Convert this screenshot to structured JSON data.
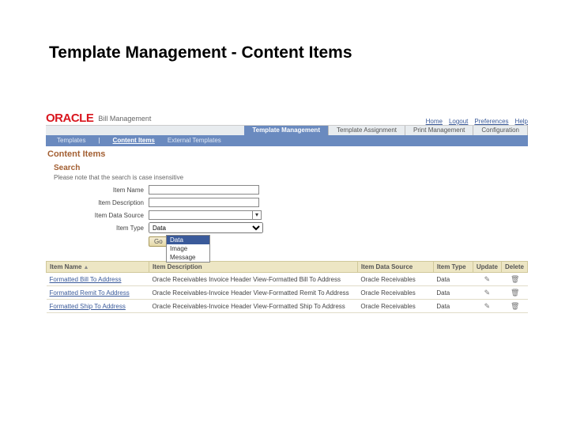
{
  "slide": {
    "title": "Template Management  - Content Items"
  },
  "header": {
    "brand": "ORACLE",
    "app_name": "Bill Management",
    "links": {
      "home": "Home",
      "logout": "Logout",
      "prefs": "Preferences",
      "help": "Help"
    }
  },
  "tabs": {
    "items": [
      {
        "label": "Template Management",
        "active": true
      },
      {
        "label": "Template Assignment",
        "active": false
      },
      {
        "label": "Print Management",
        "active": false
      },
      {
        "label": "Configuration",
        "active": false
      }
    ]
  },
  "subtabs": {
    "items": [
      {
        "label": "Templates",
        "active": false
      },
      {
        "label": "Content Items",
        "active": true
      },
      {
        "label": "External Templates",
        "active": false
      }
    ]
  },
  "page": {
    "heading": "Content Items"
  },
  "search": {
    "heading": "Search",
    "hint": "Please note that the search is case insensitive",
    "name_label": "Item Name",
    "name_value": "",
    "desc_label": "Item Description",
    "desc_value": "",
    "datasource_label": "Item Data Source",
    "datasource_value": "",
    "type_label": "Item Type",
    "type_value": "Data",
    "go_label": "Go",
    "type_options": [
      "Data",
      "Image",
      "Message"
    ]
  },
  "results": {
    "columns": {
      "name": "Item Name",
      "desc": "Item Description",
      "datasource": "Item Data Source",
      "type": "Item Type",
      "update": "Update",
      "delete": "Delete"
    },
    "rows": [
      {
        "name": "Formatted Bill To Address",
        "desc": "Oracle Receivables Invoice Header View-Formatted Bill To Address",
        "datasource": "Oracle Receivables",
        "type": "Data"
      },
      {
        "name": "Formatted Remit To Address",
        "desc": "Oracle Receivables-Invoice Header View-Formatted Remit To Address",
        "datasource": "Oracle Receivables",
        "type": "Data"
      },
      {
        "name": "Formatted Ship To Address",
        "desc": "Oracle Receivables-Invoice Header View-Formatted Ship To Address",
        "datasource": "Oracle Receivables",
        "type": "Data"
      }
    ]
  }
}
